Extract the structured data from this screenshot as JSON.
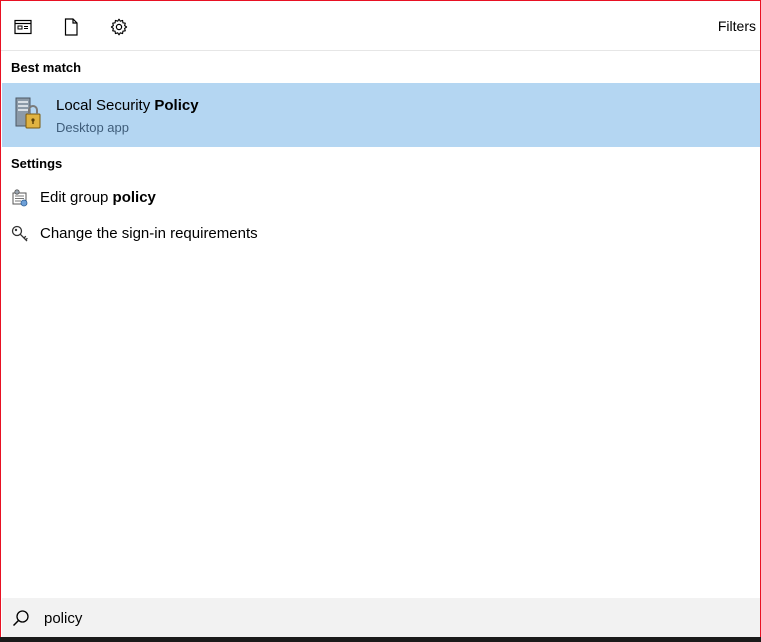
{
  "toolbar": {
    "icons": [
      "apps-icon",
      "documents-icon",
      "settings-icon"
    ],
    "filters_label": "Filters"
  },
  "best_match": {
    "header": "Best match",
    "item": {
      "title_prefix": "Local Security ",
      "title_bold": "Policy",
      "subtitle": "Desktop app",
      "icon": "local-security-policy-icon"
    }
  },
  "settings": {
    "header": "Settings",
    "items": [
      {
        "prefix": "Edit group ",
        "bold": "policy",
        "icon": "group-policy-icon"
      },
      {
        "prefix": "Change the sign-in requirements",
        "bold": "",
        "icon": "key-icon"
      }
    ]
  },
  "search": {
    "value": "policy",
    "icon": "search-icon"
  },
  "colors": {
    "selection": "#b4d6f2",
    "frame_border": "#e81123",
    "searchbar_bg": "#f2f2f2"
  }
}
